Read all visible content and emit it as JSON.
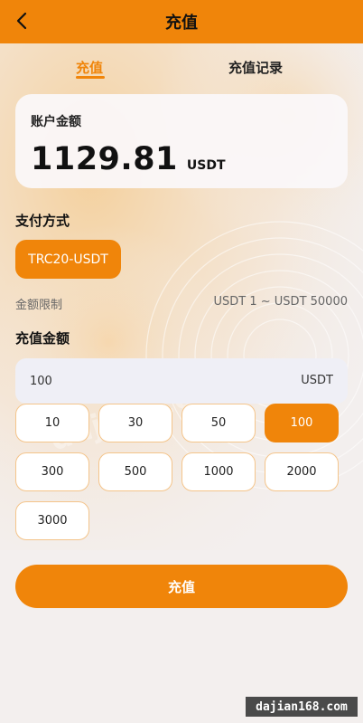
{
  "header": {
    "title": "充值",
    "back_icon": "chevron-left-icon"
  },
  "tabs": [
    {
      "label": "充值",
      "active": true
    },
    {
      "label": "充值记录",
      "active": false
    }
  ],
  "balance": {
    "label": "账户金额",
    "value": "1129.81",
    "unit": "USDT"
  },
  "payment": {
    "title": "支付方式",
    "selected_method": "TRC20-USDT"
  },
  "limit": {
    "label": "金额限制",
    "value": "USDT 1 ~ USDT 50000"
  },
  "amount": {
    "title": "充值金额",
    "value": "100",
    "unit": "USDT",
    "presets": [
      "10",
      "30",
      "50",
      "100",
      "300",
      "500",
      "1000",
      "2000",
      "3000"
    ],
    "selected": "100"
  },
  "submit_label": "充值",
  "watermark": {
    "badge": "dajian168.com",
    "overlay": "dajian168.com"
  },
  "colors": {
    "accent": "#f0850a",
    "background": "#f3efee",
    "card": "#faf8fa",
    "input": "#efeff6"
  }
}
